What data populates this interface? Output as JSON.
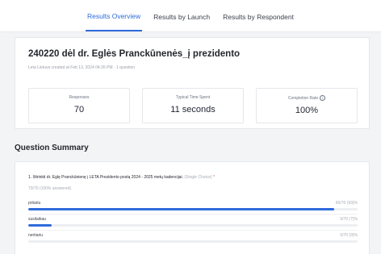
{
  "tabs": [
    {
      "label": "Results Overview",
      "active": true
    },
    {
      "label": "Results by Launch",
      "active": false
    },
    {
      "label": "Results by Respondent",
      "active": false
    }
  ],
  "survey": {
    "title": "240220 dėl dr. Eglės Pranckūnenės_į prezidento",
    "meta": "Leta Lietuva created at Feb 13, 2024 04:26 PM  ·  1 question"
  },
  "stats": {
    "responses": {
      "label": "Responses",
      "value": "70"
    },
    "time": {
      "label": "Typical Time Spent",
      "value": "11 seconds"
    },
    "completion": {
      "label": "Completion Rate",
      "value": "100%",
      "icon": "info-icon"
    }
  },
  "question_summary": {
    "title": "Question Summary",
    "question": {
      "text": "1. Ištrinkti dr. Eglę Pranckūnienę į LETA Prezidento postą 2024 - 2025 metų kadencijai.",
      "type": "(Single Choice)",
      "required_mark": "*",
      "answered": "70/70 (100% answered)",
      "options": [
        {
          "label": "pritariu",
          "count": "65/70 (93)%",
          "fraction": 0.93
        },
        {
          "label": "susilaikau",
          "count": "5/70 (7)%",
          "fraction": 0.07
        },
        {
          "label": "neritariu",
          "count": "0/70 (0)%",
          "fraction": 0.0
        }
      ]
    }
  },
  "colors": {
    "accent": "#2f6bdc",
    "track": "#eceef2"
  }
}
